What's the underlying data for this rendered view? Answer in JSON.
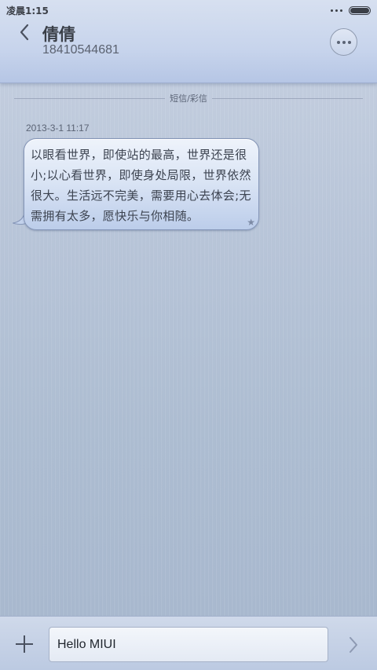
{
  "status": {
    "time": "凌晨1:15"
  },
  "header": {
    "contact_name": "倩倩",
    "contact_number": "18410544681"
  },
  "thread": {
    "divider_label": "短信/彩信",
    "timestamp": "2013-3-1 11:17",
    "messages": [
      {
        "text": "以眼看世界，即使站的最高，世界还是很小;以心看世界，即使身处局限，世界依然很大。生活远不完美，需要用心去体会;无需拥有太多，愿快乐与你相随。",
        "starred": true
      }
    ]
  },
  "composer": {
    "input_value": "Hello MIUI"
  },
  "icons": {
    "back": "chevron-left-icon",
    "more": "more-dots-icon",
    "add": "plus-icon",
    "send": "chevron-right-icon",
    "star": "star-icon"
  }
}
